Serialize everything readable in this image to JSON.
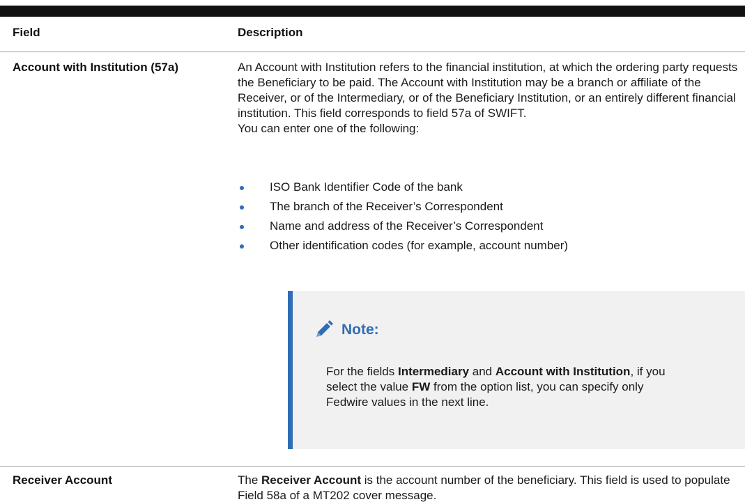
{
  "table": {
    "headers": {
      "field": "Field",
      "description": "Description"
    },
    "rows": [
      {
        "field": "Account with Institution (57a)",
        "description": "An Account with Institution refers to the financial institution, at which the ordering party requests the Beneficiary to be paid. The Account with Institution may be a branch or affiliate of the Receiver, or of the Intermediary, or of the Beneficiary Institution, or an entirely different financial institution. This field corresponds to field 57a of SWIFT.",
        "intro": "You can enter one of the following:",
        "bullets": [
          "ISO Bank Identifier Code of the bank",
          "The branch of the Receiver’s Correspondent",
          "Name and address of the Receiver’s Correspondent",
          "Other identification codes (for example, account number)"
        ],
        "note": {
          "icon": "pencil-icon",
          "title": "Note:",
          "text_1": "For the fields ",
          "bold_1": "Intermediary",
          "text_2": " and ",
          "bold_2": "Account with Institution",
          "text_3": ", if you select the value ",
          "bold_3": "FW",
          "text_4": " from the option list, you can specify only Fedwire values in the next line."
        }
      },
      {
        "field": "Receiver Account",
        "desc_text_1": "The ",
        "desc_bold_1": "Receiver Account",
        "desc_text_2": " is the account number of the beneficiary. This field is used to populate Field 58a of a MT202 cover message."
      }
    ]
  },
  "colors": {
    "accent": "#2f6db5",
    "note_background": "#f1f1f1",
    "rule": "#111111"
  }
}
